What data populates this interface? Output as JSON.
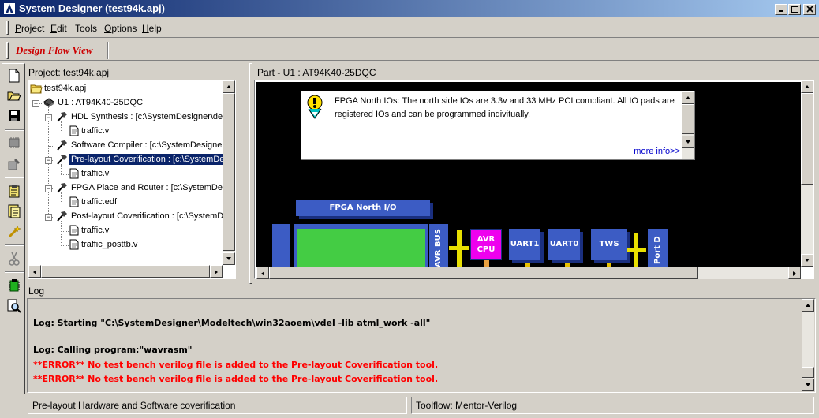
{
  "window": {
    "title": "System Designer (test94k.apj)",
    "controls": [
      "minimize",
      "maximize",
      "close"
    ]
  },
  "menu": {
    "items": [
      {
        "label": "Project",
        "mnemonic": "P"
      },
      {
        "label": "Edit",
        "mnemonic": "E"
      },
      {
        "label": "Tools",
        "mnemonic": ""
      },
      {
        "label": "Options",
        "mnemonic": "O"
      },
      {
        "label": "Help",
        "mnemonic": "H"
      }
    ]
  },
  "flow_toolbar": {
    "label": "Design Flow View",
    "label_color": "#cc0000"
  },
  "vertical_toolbar": {
    "icons": [
      "new-file-icon",
      "open-folder-icon",
      "save-icon",
      "chip-icon",
      "settings-chip-icon",
      "notepad-icon",
      "document-list-icon",
      "wand-icon",
      "scissors-icon",
      "chip-green-icon",
      "zoom-document-icon"
    ]
  },
  "project": {
    "caption": "Project: test94k.apj",
    "tree": [
      {
        "label": "test94k.apj",
        "icon": "folder-icon"
      },
      {
        "label": "U1 : AT94K40-25DQC",
        "icon": "chip-icon"
      },
      {
        "label": "HDL Synthesis :  [c:\\SystemDesigner\\desig",
        "icon": "hammer-icon"
      },
      {
        "label": "traffic.v",
        "icon": "file-icon"
      },
      {
        "label": "Software Compiler :  [c:\\SystemDesigner\\de",
        "icon": "hammer-icon"
      },
      {
        "label": "Pre-layout Coverification :  [c:\\SystemDesign",
        "icon": "hammer-icon",
        "selected": true
      },
      {
        "label": "traffic.v",
        "icon": "file-icon"
      },
      {
        "label": "FPGA Place and Router :  [c:\\SystemDesigr",
        "icon": "hammer-icon"
      },
      {
        "label": "traffic.edf",
        "icon": "file-icon"
      },
      {
        "label": "Post-layout Coverification :  [c:\\SystemDesi",
        "icon": "hammer-icon"
      },
      {
        "label": "traffic.v",
        "icon": "file-icon"
      },
      {
        "label": "traffic_posttb.v",
        "icon": "file-icon"
      }
    ]
  },
  "part": {
    "caption": "Part - U1 : AT94K40-25DQC",
    "info": {
      "text": "FPGA North IOs: The north side IOs are 3.3v and 33 MHz PCI compliant.  All IO pads are registered IOs and can be programmed indivitually.",
      "more": "more info>>"
    },
    "diagram": {
      "header_label": "FPGA North I/O",
      "avr_bus": "AVR BUS",
      "avr_cpu": "AVR CPU",
      "uart1": "UART1",
      "uart0": "UART0",
      "tws": "TWS",
      "port_d": "Port D",
      "colors": {
        "block": "#3c5cc4",
        "fpga": "#44cc44",
        "cpu": "#ee00ee",
        "bus": "#e8e000",
        "canvas": "#000000"
      }
    }
  },
  "log": {
    "caption": "Log",
    "lines": [
      {
        "text": "Log: Starting \"C:\\SystemDesigner\\Modeltech\\win32aoem\\vdel -lib atml_work -all\"",
        "level": "info"
      },
      {
        "text": "Log: Calling program:\"wavrasm\"",
        "level": "info"
      },
      {
        "text": "**ERROR** No test bench verilog file is added to the Pre-layout Coverification tool.",
        "level": "error"
      },
      {
        "text": "**ERROR** No test bench verilog file is added to the Pre-layout Coverification tool.",
        "level": "error"
      }
    ]
  },
  "status": {
    "left": "Pre-layout Hardware and Software coverification",
    "right": "Toolflow: Mentor-Verilog"
  }
}
